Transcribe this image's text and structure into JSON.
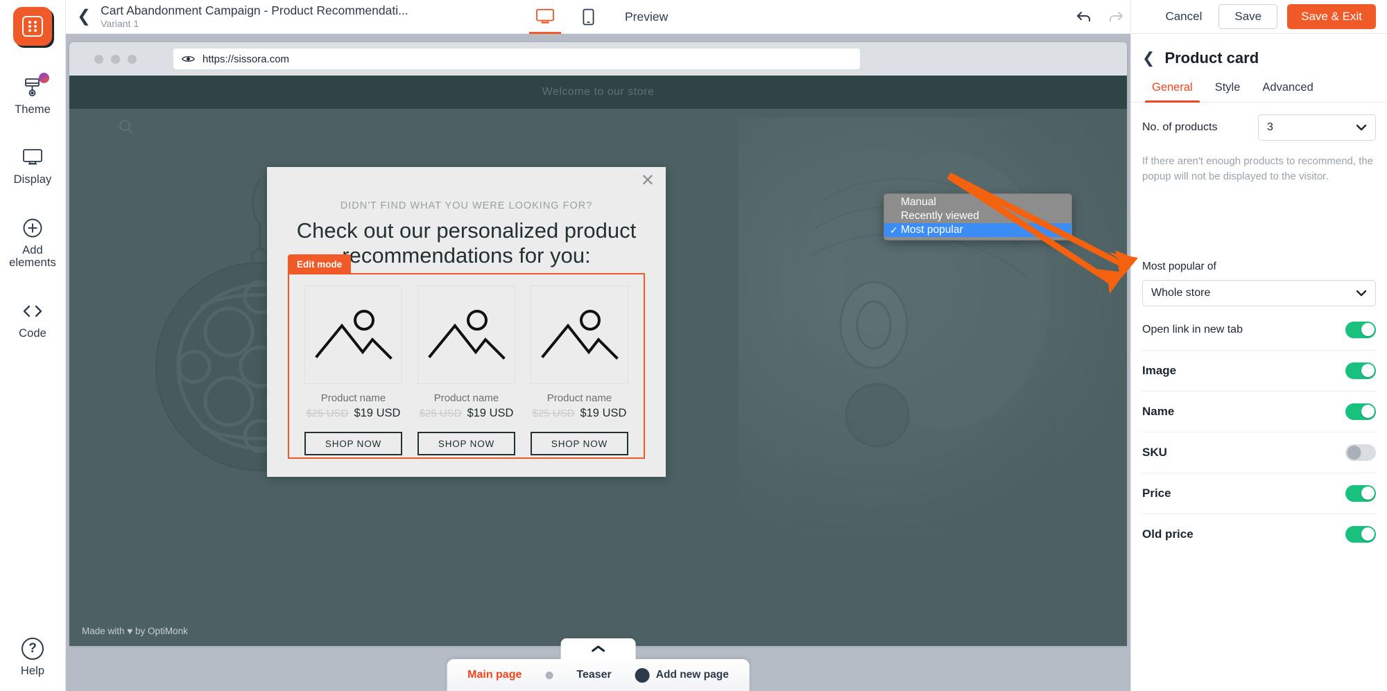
{
  "rail": {
    "logo_icon": "optimonk-logo-icon",
    "items": [
      {
        "label": "Theme",
        "icon": "paint-roller-icon",
        "badge": true
      },
      {
        "label": "Display",
        "icon": "monitor-icon",
        "badge": false
      },
      {
        "label": "Add\nelements",
        "label_line1": "Add",
        "label_line2": "elements",
        "icon": "plus-circle-icon",
        "badge": false
      },
      {
        "label": "Code",
        "icon": "code-brackets-icon",
        "badge": false
      }
    ],
    "help_label": "Help",
    "help_icon": "question-mark-icon"
  },
  "topbar": {
    "back_icon": "chevron-left-icon",
    "campaign_title": "Cart Abandonment Campaign - Product Recommendati...",
    "variant": "Variant 1",
    "desktop_icon": "desktop-monitor-icon",
    "mobile_icon": "mobile-phone-icon",
    "preview_label": "Preview",
    "undo_icon": "undo-arrow-icon",
    "redo_icon": "redo-arrow-icon",
    "active_device": "desktop"
  },
  "browser": {
    "eye_icon": "eye-icon",
    "url": "https://sissora.com"
  },
  "site": {
    "header_text": "Welcome to our store",
    "search_icon": "search-icon",
    "bag_icon": "shopping-bag-icon",
    "footer_credit": "Made with ♥ by OptiMonk"
  },
  "popup": {
    "close_icon": "close-x-icon",
    "kicker": "DIDN'T FIND WHAT YOU WERE LOOKING FOR?",
    "headline": "Check out our personalized product recommendations for you:",
    "edit_mode_tag": "Edit mode",
    "products": [
      {
        "image_icon": "image-placeholder-icon",
        "name": "Product name",
        "old_price": "$25 USD",
        "price": "$19 USD",
        "cta": "SHOP NOW"
      },
      {
        "image_icon": "image-placeholder-icon",
        "name": "Product name",
        "old_price": "$25 USD",
        "price": "$19 USD",
        "cta": "SHOP NOW"
      },
      {
        "image_icon": "image-placeholder-icon",
        "name": "Product name",
        "old_price": "$25 USD",
        "price": "$19 USD",
        "cta": "SHOP NOW"
      }
    ]
  },
  "pagebar": {
    "collapse_icon": "chevron-up-icon",
    "tabs": [
      {
        "label": "Main page",
        "active": true
      },
      {
        "label": "Teaser",
        "active": false
      }
    ],
    "add_page_label": "Add new page",
    "add_icon": "plus-circle-filled-icon"
  },
  "right_panel": {
    "actions": {
      "cancel": "Cancel",
      "save": "Save",
      "save_exit": "Save & Exit"
    },
    "back_icon": "chevron-left-icon",
    "title": "Product card",
    "tabs": [
      {
        "label": "General",
        "active": true
      },
      {
        "label": "Style",
        "active": false
      },
      {
        "label": "Advanced",
        "active": false
      }
    ],
    "no_of_products": {
      "label": "No. of products",
      "value": "3",
      "caret_icon": "chevron-down-icon"
    },
    "hint": "If there aren't enough products to recommend, the popup will not be displayed to the visitor.",
    "recommendation_type": {
      "open": true,
      "options": [
        {
          "label": "Manual",
          "selected": false
        },
        {
          "label": "Recently viewed",
          "selected": false
        },
        {
          "label": "Most popular",
          "selected": true
        }
      ],
      "check_icon": "checkmark-icon"
    },
    "most_popular_of": {
      "label": "Most popular of",
      "value": "Whole store",
      "caret_icon": "chevron-down-icon"
    },
    "toggles": [
      {
        "label": "Open link in new tab",
        "on": true,
        "bold": false
      },
      {
        "label": "Image",
        "on": true,
        "bold": true
      },
      {
        "label": "Name",
        "on": true,
        "bold": true
      },
      {
        "label": "SKU",
        "on": false,
        "bold": true
      },
      {
        "label": "Price",
        "on": true,
        "bold": true
      },
      {
        "label": "Old price",
        "on": true,
        "bold": true
      }
    ]
  },
  "colors": {
    "accent": "#f05a28",
    "accent_text": "#f0451e",
    "toggle_on": "#18c27e",
    "dropdown_selected": "#3b8cf5",
    "dropdown_bg": "#8d8d8d",
    "site_bg": "#4d6164",
    "popup_bg": "#ececec",
    "workspace_bg": "#b5bcc6"
  }
}
